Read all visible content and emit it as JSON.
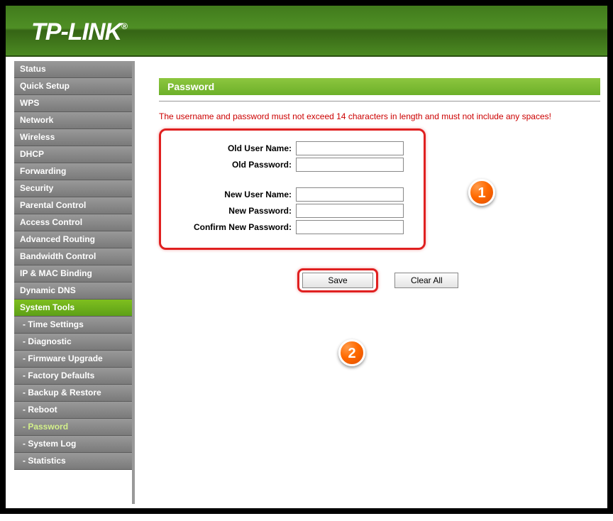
{
  "brand": {
    "name": "TP-LINK",
    "reg": "®"
  },
  "sidebar": {
    "items": [
      {
        "label": "Status"
      },
      {
        "label": "Quick Setup"
      },
      {
        "label": "WPS"
      },
      {
        "label": "Network"
      },
      {
        "label": "Wireless"
      },
      {
        "label": "DHCP"
      },
      {
        "label": "Forwarding"
      },
      {
        "label": "Security"
      },
      {
        "label": "Parental Control"
      },
      {
        "label": "Access Control"
      },
      {
        "label": "Advanced Routing"
      },
      {
        "label": "Bandwidth Control"
      },
      {
        "label": "IP & MAC Binding"
      },
      {
        "label": "Dynamic DNS"
      },
      {
        "label": "System Tools"
      },
      {
        "label": "- Time Settings"
      },
      {
        "label": "- Diagnostic"
      },
      {
        "label": "- Firmware Upgrade"
      },
      {
        "label": "- Factory Defaults"
      },
      {
        "label": "- Backup & Restore"
      },
      {
        "label": "- Reboot"
      },
      {
        "label": "- Password"
      },
      {
        "label": "- System Log"
      },
      {
        "label": "- Statistics"
      }
    ]
  },
  "page": {
    "title": "Password",
    "warning": "The username and password must not exceed 14 characters in length and must not include any spaces!",
    "labels": {
      "old_user": "Old User Name:",
      "old_pass": "Old Password:",
      "new_user": "New User Name:",
      "new_pass": "New Password:",
      "confirm": "Confirm New Password:"
    },
    "values": {
      "old_user": "",
      "old_pass": "",
      "new_user": "",
      "new_pass": "",
      "confirm": ""
    },
    "buttons": {
      "save": "Save",
      "clear": "Clear All"
    }
  },
  "callouts": {
    "one": "1",
    "two": "2"
  }
}
